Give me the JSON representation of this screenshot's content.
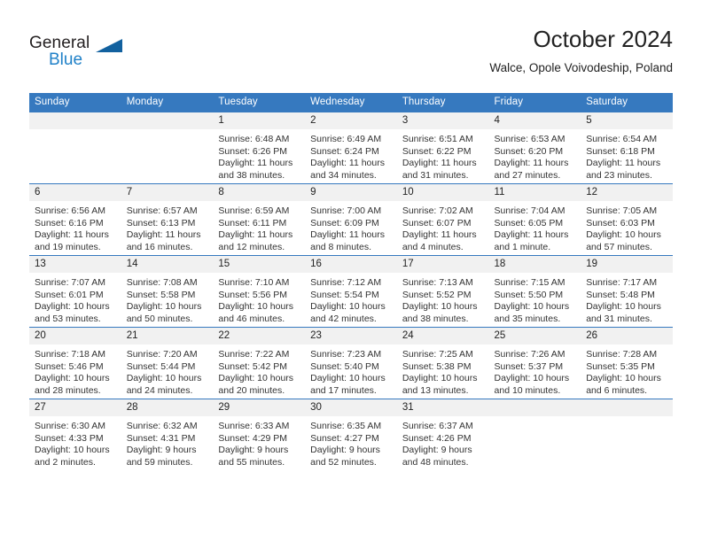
{
  "brand": {
    "name_part1": "General",
    "name_part2": "Blue",
    "triangle_color": "#12619f",
    "blue_color": "#2081c8",
    "icon": "general-blue-logo"
  },
  "header": {
    "title": "October 2024",
    "location": "Walce, Opole Voivodeship, Poland"
  },
  "colors": {
    "header_blue": "#3679bf",
    "daynum_gray": "#f1f1f1",
    "text": "#222222"
  },
  "weekday_headers": [
    "Sunday",
    "Monday",
    "Tuesday",
    "Wednesday",
    "Thursday",
    "Friday",
    "Saturday"
  ],
  "weeks": [
    [
      {
        "day": "",
        "sunrise": "",
        "sunset": "",
        "daylight": ""
      },
      {
        "day": "",
        "sunrise": "",
        "sunset": "",
        "daylight": ""
      },
      {
        "day": "1",
        "sunrise": "Sunrise: 6:48 AM",
        "sunset": "Sunset: 6:26 PM",
        "daylight": "Daylight: 11 hours and 38 minutes."
      },
      {
        "day": "2",
        "sunrise": "Sunrise: 6:49 AM",
        "sunset": "Sunset: 6:24 PM",
        "daylight": "Daylight: 11 hours and 34 minutes."
      },
      {
        "day": "3",
        "sunrise": "Sunrise: 6:51 AM",
        "sunset": "Sunset: 6:22 PM",
        "daylight": "Daylight: 11 hours and 31 minutes."
      },
      {
        "day": "4",
        "sunrise": "Sunrise: 6:53 AM",
        "sunset": "Sunset: 6:20 PM",
        "daylight": "Daylight: 11 hours and 27 minutes."
      },
      {
        "day": "5",
        "sunrise": "Sunrise: 6:54 AM",
        "sunset": "Sunset: 6:18 PM",
        "daylight": "Daylight: 11 hours and 23 minutes."
      }
    ],
    [
      {
        "day": "6",
        "sunrise": "Sunrise: 6:56 AM",
        "sunset": "Sunset: 6:16 PM",
        "daylight": "Daylight: 11 hours and 19 minutes."
      },
      {
        "day": "7",
        "sunrise": "Sunrise: 6:57 AM",
        "sunset": "Sunset: 6:13 PM",
        "daylight": "Daylight: 11 hours and 16 minutes."
      },
      {
        "day": "8",
        "sunrise": "Sunrise: 6:59 AM",
        "sunset": "Sunset: 6:11 PM",
        "daylight": "Daylight: 11 hours and 12 minutes."
      },
      {
        "day": "9",
        "sunrise": "Sunrise: 7:00 AM",
        "sunset": "Sunset: 6:09 PM",
        "daylight": "Daylight: 11 hours and 8 minutes."
      },
      {
        "day": "10",
        "sunrise": "Sunrise: 7:02 AM",
        "sunset": "Sunset: 6:07 PM",
        "daylight": "Daylight: 11 hours and 4 minutes."
      },
      {
        "day": "11",
        "sunrise": "Sunrise: 7:04 AM",
        "sunset": "Sunset: 6:05 PM",
        "daylight": "Daylight: 11 hours and 1 minute."
      },
      {
        "day": "12",
        "sunrise": "Sunrise: 7:05 AM",
        "sunset": "Sunset: 6:03 PM",
        "daylight": "Daylight: 10 hours and 57 minutes."
      }
    ],
    [
      {
        "day": "13",
        "sunrise": "Sunrise: 7:07 AM",
        "sunset": "Sunset: 6:01 PM",
        "daylight": "Daylight: 10 hours and 53 minutes."
      },
      {
        "day": "14",
        "sunrise": "Sunrise: 7:08 AM",
        "sunset": "Sunset: 5:58 PM",
        "daylight": "Daylight: 10 hours and 50 minutes."
      },
      {
        "day": "15",
        "sunrise": "Sunrise: 7:10 AM",
        "sunset": "Sunset: 5:56 PM",
        "daylight": "Daylight: 10 hours and 46 minutes."
      },
      {
        "day": "16",
        "sunrise": "Sunrise: 7:12 AM",
        "sunset": "Sunset: 5:54 PM",
        "daylight": "Daylight: 10 hours and 42 minutes."
      },
      {
        "day": "17",
        "sunrise": "Sunrise: 7:13 AM",
        "sunset": "Sunset: 5:52 PM",
        "daylight": "Daylight: 10 hours and 38 minutes."
      },
      {
        "day": "18",
        "sunrise": "Sunrise: 7:15 AM",
        "sunset": "Sunset: 5:50 PM",
        "daylight": "Daylight: 10 hours and 35 minutes."
      },
      {
        "day": "19",
        "sunrise": "Sunrise: 7:17 AM",
        "sunset": "Sunset: 5:48 PM",
        "daylight": "Daylight: 10 hours and 31 minutes."
      }
    ],
    [
      {
        "day": "20",
        "sunrise": "Sunrise: 7:18 AM",
        "sunset": "Sunset: 5:46 PM",
        "daylight": "Daylight: 10 hours and 28 minutes."
      },
      {
        "day": "21",
        "sunrise": "Sunrise: 7:20 AM",
        "sunset": "Sunset: 5:44 PM",
        "daylight": "Daylight: 10 hours and 24 minutes."
      },
      {
        "day": "22",
        "sunrise": "Sunrise: 7:22 AM",
        "sunset": "Sunset: 5:42 PM",
        "daylight": "Daylight: 10 hours and 20 minutes."
      },
      {
        "day": "23",
        "sunrise": "Sunrise: 7:23 AM",
        "sunset": "Sunset: 5:40 PM",
        "daylight": "Daylight: 10 hours and 17 minutes."
      },
      {
        "day": "24",
        "sunrise": "Sunrise: 7:25 AM",
        "sunset": "Sunset: 5:38 PM",
        "daylight": "Daylight: 10 hours and 13 minutes."
      },
      {
        "day": "25",
        "sunrise": "Sunrise: 7:26 AM",
        "sunset": "Sunset: 5:37 PM",
        "daylight": "Daylight: 10 hours and 10 minutes."
      },
      {
        "day": "26",
        "sunrise": "Sunrise: 7:28 AM",
        "sunset": "Sunset: 5:35 PM",
        "daylight": "Daylight: 10 hours and 6 minutes."
      }
    ],
    [
      {
        "day": "27",
        "sunrise": "Sunrise: 6:30 AM",
        "sunset": "Sunset: 4:33 PM",
        "daylight": "Daylight: 10 hours and 2 minutes."
      },
      {
        "day": "28",
        "sunrise": "Sunrise: 6:32 AM",
        "sunset": "Sunset: 4:31 PM",
        "daylight": "Daylight: 9 hours and 59 minutes."
      },
      {
        "day": "29",
        "sunrise": "Sunrise: 6:33 AM",
        "sunset": "Sunset: 4:29 PM",
        "daylight": "Daylight: 9 hours and 55 minutes."
      },
      {
        "day": "30",
        "sunrise": "Sunrise: 6:35 AM",
        "sunset": "Sunset: 4:27 PM",
        "daylight": "Daylight: 9 hours and 52 minutes."
      },
      {
        "day": "31",
        "sunrise": "Sunrise: 6:37 AM",
        "sunset": "Sunset: 4:26 PM",
        "daylight": "Daylight: 9 hours and 48 minutes."
      },
      {
        "day": "",
        "sunrise": "",
        "sunset": "",
        "daylight": ""
      },
      {
        "day": "",
        "sunrise": "",
        "sunset": "",
        "daylight": ""
      }
    ]
  ]
}
